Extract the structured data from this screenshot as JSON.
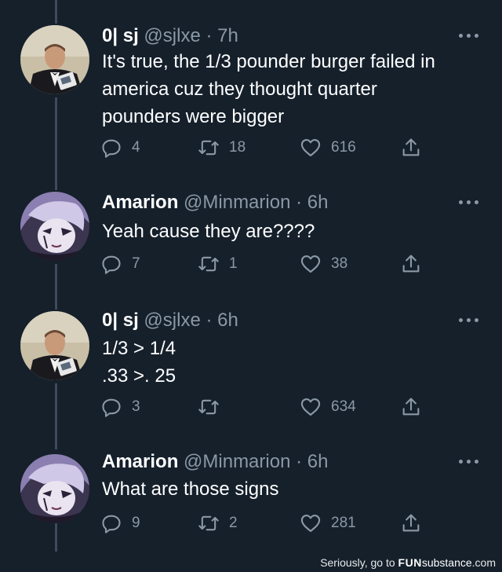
{
  "tweets": [
    {
      "name": "0| sj",
      "handle": "@sjlxe",
      "time": "· 7h",
      "lines": [
        "It's true, the 1/3 pounder burger failed in",
        "america cuz they thought quarter",
        "pounders were bigger"
      ],
      "replies": "4",
      "retweets": "18",
      "likes": "616",
      "avatar": "man-in-tuxedo-avatar"
    },
    {
      "name": "Amarion",
      "handle": "@Minmarion",
      "time": "· 6h",
      "lines": [
        "Yeah cause they are????"
      ],
      "replies": "7",
      "retweets": "1",
      "likes": "38",
      "avatar": "anime-character-avatar"
    },
    {
      "name": "0| sj",
      "handle": "@sjlxe",
      "time": "· 6h",
      "lines": [
        "1/3 > 1/4",
        ".33 >. 25"
      ],
      "replies": "3",
      "retweets": "",
      "likes": "634",
      "avatar": "man-in-tuxedo-avatar"
    },
    {
      "name": "Amarion",
      "handle": "@Minmarion",
      "time": "· 6h",
      "lines": [
        "What are those signs"
      ],
      "replies": "9",
      "retweets": "2",
      "likes": "281",
      "avatar": "anime-character-avatar"
    }
  ],
  "footer": {
    "prefix": "Seriously, go to ",
    "brand_fun": "FUN",
    "brand_rest": "substance",
    "suffix": ".com"
  },
  "colors": {
    "background": "#15202b",
    "secondary_text": "#8b98a5",
    "thread_line": "#3d4b5a"
  }
}
